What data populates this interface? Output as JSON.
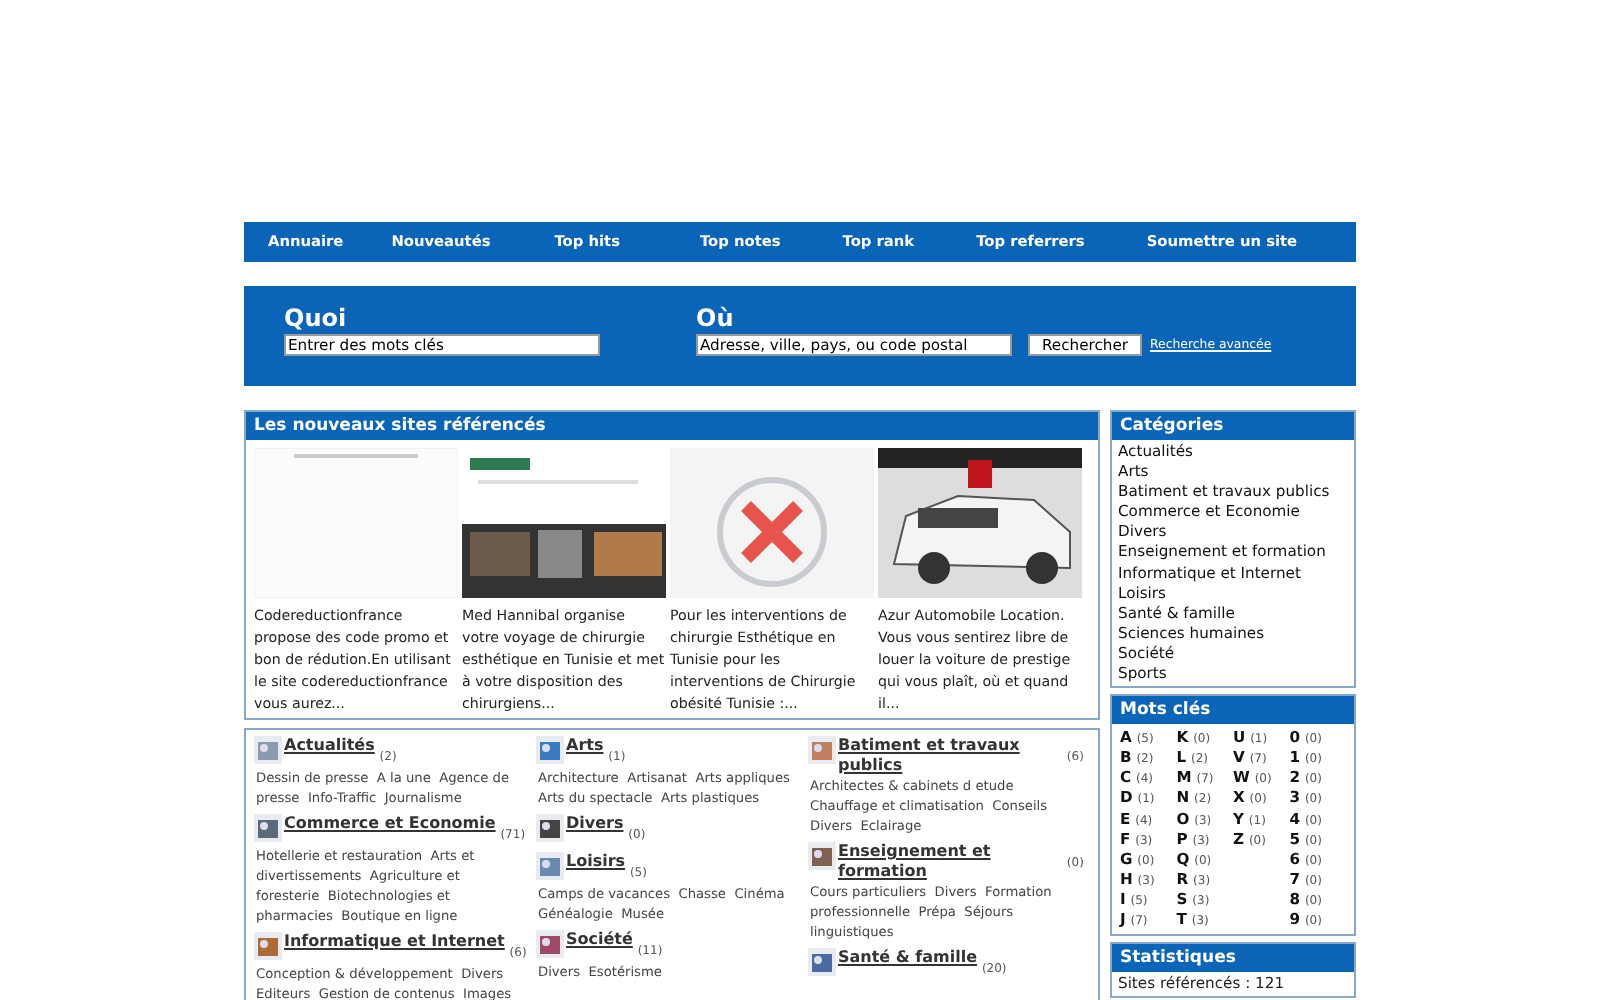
{
  "nav": [
    {
      "label": "Annuaire"
    },
    {
      "label": "Nouveautés"
    },
    {
      "label": "Top hits"
    },
    {
      "label": "Top notes"
    },
    {
      "label": "Top rank"
    },
    {
      "label": "Top referrers"
    },
    {
      "label": "Soumettre un site"
    }
  ],
  "search": {
    "what_label": "Quoi",
    "what_value": "Entrer des mots clés",
    "where_label": "Où",
    "where_value": "Adresse, ville, pays, ou code postal",
    "button": "Rechercher",
    "advanced_link": "Recherche avancée"
  },
  "new_sites": {
    "title": "Les nouveaux sites référencés",
    "items": [
      {
        "kind": "blank",
        "description": "Codereductionfrance propose des code promo et bon de rédution.En utilisant le site codereductionfrance vous aurez..."
      },
      {
        "kind": "site",
        "description": "Med Hannibal organise votre voyage de chirurgie esthétique en Tunisie et met à votre disposition des chirurgiens..."
      },
      {
        "kind": "error",
        "description": "Pour les interventions de chirurgie Esthétique en Tunisie pour les interventions de Chirurgie obésité Tunisie :..."
      },
      {
        "kind": "car",
        "description": "Azur Automobile Location. Vous vous sentirez libre de louer la voiture de prestige qui vous plaît, où et quand il..."
      }
    ]
  },
  "directory": [
    [
      {
        "title": "Actualités",
        "count": "(2)",
        "subcategories": [
          "Dessin de presse",
          "A la une",
          "Agence de presse",
          "Info-Traffic",
          "Journalisme"
        ]
      },
      {
        "title": "Commerce et Economie",
        "count": "(71)",
        "subcategories": [
          "Hotellerie et restauration",
          "Arts et divertissements",
          "Agriculture et foresterie",
          "Biotechnologies et pharmacies",
          "Boutique en ligne"
        ]
      },
      {
        "title": "Informatique et Internet",
        "count": "(6)",
        "subcategories": [
          "Conception & développement",
          "Divers",
          "Editeurs",
          "Gestion de contenus",
          "Images"
        ]
      }
    ],
    [
      {
        "title": "Arts",
        "count": "(1)",
        "subcategories": [
          "Architecture",
          "Artisanat",
          "Arts appliques",
          "Arts du spectacle",
          "Arts plastiques"
        ]
      },
      {
        "title": "Divers",
        "count": "(0)"
      },
      {
        "title": "Loisirs",
        "count": "(5)",
        "subcategories": [
          "Camps de vacances",
          "Chasse",
          "Cinéma",
          "Généalogie",
          "Musée"
        ]
      },
      {
        "title": "Société",
        "count": "(11)",
        "subcategories": [
          "Divers",
          "Esotérisme"
        ]
      }
    ],
    [
      {
        "title": "Batiment et travaux publics",
        "count": "(6)",
        "subcategories": [
          "Architectes & cabinets d etude",
          "Chauffage et climatisation",
          "Conseils",
          "Divers",
          "Eclairage"
        ]
      },
      {
        "title": "Enseignement et formation",
        "count": "(0)",
        "subcategories": [
          "Cours particuliers",
          "Divers",
          "Formation professionnelle",
          "Prépa",
          "Séjours linguistiques"
        ]
      },
      {
        "title": "Santé & famille",
        "count": "(20)"
      }
    ]
  ],
  "categories": {
    "title": "Catégories",
    "items": [
      "Actualités",
      "Arts",
      "Batiment et travaux publics",
      "Commerce et Economie",
      "Divers",
      "Enseignement et formation",
      "Informatique et Internet",
      "Loisirs",
      "Santé & famille",
      "Sciences humaines",
      "Société",
      "Sports"
    ]
  },
  "keywords": {
    "title": "Mots clés",
    "columns": [
      [
        {
          "letter": "A",
          "count": "(5)"
        },
        {
          "letter": "B",
          "count": "(2)"
        },
        {
          "letter": "C",
          "count": "(4)"
        },
        {
          "letter": "D",
          "count": "(1)"
        },
        {
          "letter": "E",
          "count": "(4)"
        },
        {
          "letter": "F",
          "count": "(3)"
        },
        {
          "letter": "G",
          "count": "(0)"
        },
        {
          "letter": "H",
          "count": "(3)"
        },
        {
          "letter": "I",
          "count": "(5)"
        },
        {
          "letter": "J",
          "count": "(7)"
        }
      ],
      [
        {
          "letter": "K",
          "count": "(0)"
        },
        {
          "letter": "L",
          "count": "(2)"
        },
        {
          "letter": "M",
          "count": "(7)"
        },
        {
          "letter": "N",
          "count": "(2)"
        },
        {
          "letter": "O",
          "count": "(3)"
        },
        {
          "letter": "P",
          "count": "(3)"
        },
        {
          "letter": "Q",
          "count": "(0)"
        },
        {
          "letter": "R",
          "count": "(3)"
        },
        {
          "letter": "S",
          "count": "(3)"
        },
        {
          "letter": "T",
          "count": "(3)"
        }
      ],
      [
        {
          "letter": "U",
          "count": "(1)"
        },
        {
          "letter": "V",
          "count": "(7)"
        },
        {
          "letter": "W",
          "count": "(0)"
        },
        {
          "letter": "X",
          "count": "(0)"
        },
        {
          "letter": "Y",
          "count": "(1)"
        },
        {
          "letter": "Z",
          "count": "(0)"
        }
      ],
      [
        {
          "letter": "0",
          "count": "(0)"
        },
        {
          "letter": "1",
          "count": "(0)"
        },
        {
          "letter": "2",
          "count": "(0)"
        },
        {
          "letter": "3",
          "count": "(0)"
        },
        {
          "letter": "4",
          "count": "(0)"
        },
        {
          "letter": "5",
          "count": "(0)"
        },
        {
          "letter": "6",
          "count": "(0)"
        },
        {
          "letter": "7",
          "count": "(0)"
        },
        {
          "letter": "8",
          "count": "(0)"
        },
        {
          "letter": "9",
          "count": "(0)"
        }
      ]
    ]
  },
  "stats": {
    "title": "Statistiques",
    "lines": [
      "Sites référencés : 121"
    ]
  }
}
